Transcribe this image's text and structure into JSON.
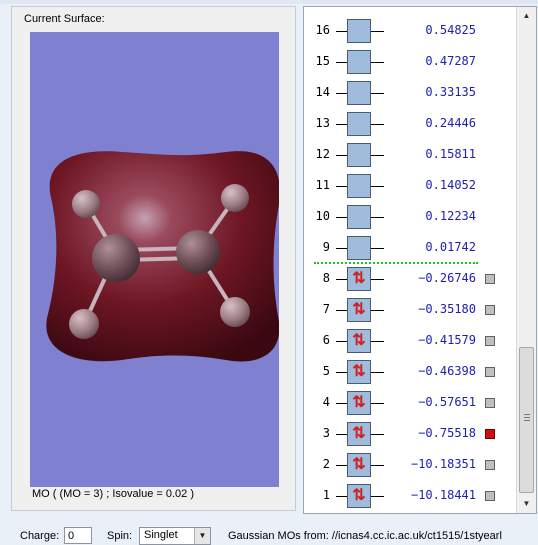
{
  "surface_panel": {
    "title": "Current Surface:",
    "status": "MO ( (MO = 3) ; Isovalue = 0.02 )"
  },
  "mo_levels": [
    {
      "number": "16",
      "energy": "0.54825",
      "occupied": false,
      "checkbox": false
    },
    {
      "number": "15",
      "energy": "0.47287",
      "occupied": false,
      "checkbox": false
    },
    {
      "number": "14",
      "energy": "0.33135",
      "occupied": false,
      "checkbox": false
    },
    {
      "number": "13",
      "energy": "0.24446",
      "occupied": false,
      "checkbox": false
    },
    {
      "number": "12",
      "energy": "0.15811",
      "occupied": false,
      "checkbox": false
    },
    {
      "number": "11",
      "energy": "0.14052",
      "occupied": false,
      "checkbox": false
    },
    {
      "number": "10",
      "energy": "0.12234",
      "occupied": false,
      "checkbox": false
    },
    {
      "number": "9",
      "energy": "0.01742",
      "occupied": false,
      "checkbox": false
    },
    {
      "number": "8",
      "energy": "−0.26746",
      "occupied": true,
      "checkbox": true,
      "selected": false
    },
    {
      "number": "7",
      "energy": "−0.35180",
      "occupied": true,
      "checkbox": true,
      "selected": false
    },
    {
      "number": "6",
      "energy": "−0.41579",
      "occupied": true,
      "checkbox": true,
      "selected": false
    },
    {
      "number": "5",
      "energy": "−0.46398",
      "occupied": true,
      "checkbox": true,
      "selected": false
    },
    {
      "number": "4",
      "energy": "−0.57651",
      "occupied": true,
      "checkbox": true,
      "selected": false
    },
    {
      "number": "3",
      "energy": "−0.75518",
      "occupied": true,
      "checkbox": true,
      "selected": true
    },
    {
      "number": "2",
      "energy": "−10.18351",
      "occupied": true,
      "checkbox": true,
      "selected": false
    },
    {
      "number": "1",
      "energy": "−10.18441",
      "occupied": true,
      "checkbox": true,
      "selected": false
    }
  ],
  "bottom": {
    "charge_label": "Charge:",
    "charge_value": "0",
    "spin_label": "Spin:",
    "spin_value": "Singlet",
    "source_text": "Gaussian MOs from:  //icnas4.cc.ic.ac.uk/ct1515/1styearl"
  },
  "icons": {
    "electron_pair": "⇅",
    "scroll_up": "▲",
    "scroll_down": "▼",
    "dropdown": "▼"
  },
  "colors": {
    "viewport_bg": "#8080d0",
    "orbital_surface": "#6b1420",
    "energy_text": "#2020b0",
    "homo_lumo_separator": "#20c020",
    "selected_checkbox": "#d01010"
  }
}
